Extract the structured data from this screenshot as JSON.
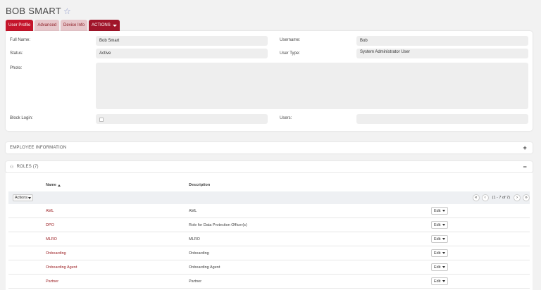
{
  "page": {
    "title": "BOB SMART"
  },
  "tabs": [
    {
      "label": "User Profile"
    },
    {
      "label": "Advanced"
    },
    {
      "label": "Device Info"
    },
    {
      "label": "ACTIONS"
    }
  ],
  "profile": {
    "full_name_label": "Full Name:",
    "full_name": "Bob Smart",
    "username_label": "Username:",
    "username": "Bob",
    "status_label": "Status:",
    "status": "Active",
    "user_type_label": "User Type:",
    "user_type": "System Administrator User",
    "photo_label": "Photo:",
    "block_login_label": "Block Login:",
    "users_label": "Users:"
  },
  "sections": {
    "employee": {
      "label": "EMPLOYEE INFORMATION",
      "toggle": "+"
    },
    "roles": {
      "label": "ROLES (7)",
      "toggle": "−"
    }
  },
  "roles_table": {
    "col_name": "Name",
    "col_desc": "Description",
    "actions_label": "Actions",
    "pager_info": "(1 - 7 of 7)",
    "edit_label": "Edit",
    "rows": [
      {
        "name": "AML",
        "desc": "AML"
      },
      {
        "name": "DPO",
        "desc": "Role for Data Protection Officer(s)"
      },
      {
        "name": "MLRO",
        "desc": "MLRO"
      },
      {
        "name": "Onboarding",
        "desc": "Onboarding"
      },
      {
        "name": "Onboarding Agent",
        "desc": "Onboarding Agent"
      },
      {
        "name": "Partner",
        "desc": "Partner"
      }
    ]
  },
  "colors": {
    "accent": "#c4152b",
    "link": "#9a1b1f"
  }
}
